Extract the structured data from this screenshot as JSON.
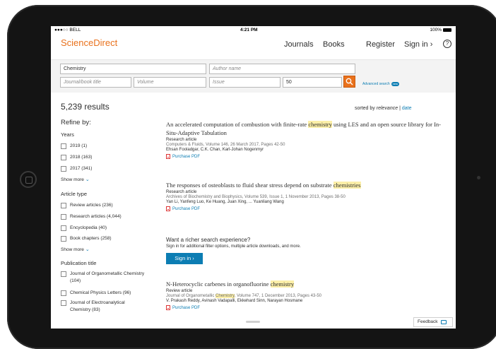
{
  "statusbar": {
    "carrier": "●●●○○ BELL",
    "time": "4:21 PM",
    "battery": "100%"
  },
  "header": {
    "logo": "ScienceDirect",
    "nav": {
      "journals": "Journals",
      "books": "Books",
      "register": "Register",
      "signin": "Sign in",
      "signin_chevron": "›"
    },
    "help": "?"
  },
  "search": {
    "keywords_value": "Chemistry",
    "author_placeholder": "Author name",
    "journal_placeholder": "Journal/book title",
    "volume_placeholder": "Volume",
    "issue_placeholder": "Issue",
    "pages_value": "50",
    "advanced_label": "Advanced search",
    "new_badge": "new"
  },
  "sidebar": {
    "results_count": "5,239 results",
    "refine_label": "Refine by:",
    "years": {
      "title": "Years",
      "items": [
        "2019 (1)",
        "2018 (163)",
        "2017 (341)"
      ],
      "show_more": "Show more"
    },
    "article_type": {
      "title": "Article type",
      "items": [
        "Review articles (236)",
        "Research articles (4,044)",
        "Encyclopedia (40)",
        "Book chapters (258)"
      ],
      "show_more": "Show more"
    },
    "publication": {
      "title": "Publication title",
      "items": [
        "Journal of Organometallic Chemistry (104)",
        "Chemical Physics Letters (96)",
        "Journal of Electroanalytical Chemistry (83)"
      ]
    }
  },
  "sort": {
    "prefix": "sorted by",
    "relevance": "relevance",
    "separator": "|",
    "date": "date"
  },
  "results": [
    {
      "title_a": "An accelerated computation of combustion with finite-rate ",
      "title_hl": "chemistry",
      "title_b": " using LES and an open source library for In-Situ-Adaptive Tabulation",
      "type": "Research article",
      "source": "Computers & Fluids, Volume 146, 26 March 2017, Pages 42-50",
      "authors": "Ehsan Fooladgar, C.K. Chan, Karl-Johan Nogenmyr",
      "pdf": "Purchase PDF"
    },
    {
      "title_a": "The responses of osteoblasts to fluid shear stress depend on substrate ",
      "title_hl": "chemistries",
      "title_b": "",
      "type": "Research article",
      "source": "Archives of Biochemistry and Biophysics, Volume 539, Issue 1, 1 November 2013, Pages 38-50",
      "authors": "Yan Li, Yanfeng Luo, Ke Huang, Juan Xing, ... Yuanliang Wang",
      "pdf": "Purchase PDF"
    },
    {
      "title_a": "N-Heterocyclic carbenes in organofluorine ",
      "title_hl": "chemistry",
      "title_b": "",
      "type": "Review article",
      "source_a": "Journal of Organometallic ",
      "source_hl": "Chemistry",
      "source_b": ", Volume 747, 1 December 2013, Pages 43-50",
      "authors": "V. Prakash Reddy, Avinash Vadapalli, Ekkehard Sinn, Narayan Hosmane",
      "pdf": "Purchase PDF"
    }
  ],
  "promo": {
    "title": "Want a richer search experience?",
    "subtitle": "Sign in for additional filter options, multiple article downloads, and more.",
    "button": "Sign in",
    "button_chevron": "›"
  },
  "feedback": "Feedback",
  "colors": {
    "brand": "#e9711c",
    "link": "#0c7db3",
    "highlight": "#fcefa8"
  }
}
